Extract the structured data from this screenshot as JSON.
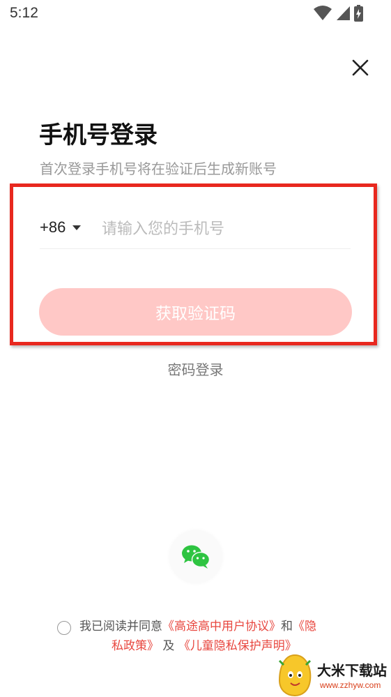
{
  "status_bar": {
    "time": "5:12",
    "icons": [
      "wifi-icon",
      "cellular-signal-icon",
      "battery-charging-icon"
    ]
  },
  "close_icon": "close-icon",
  "header": {
    "title": "手机号登录",
    "subtitle": "首次登录手机号将在验证后生成新账号"
  },
  "form": {
    "country_code": "+86",
    "phone_placeholder": "请输入您的手机号",
    "phone_value": "",
    "get_code_label": "获取验证码"
  },
  "alt_login": {
    "password_login_label": "密码登录",
    "wechat_icon": "wechat-icon"
  },
  "agreement": {
    "prefix": "我已阅读并同意",
    "user_agreement": "《高途高中用户协议》",
    "and": "和",
    "privacy_policy_part1": "《隐",
    "privacy_policy_part2": "私政策》",
    "and2": "及",
    "child_privacy": "《儿童隐私保护声明》"
  },
  "watermark": {
    "name": "大米下载站",
    "url": "www.zzhyw.com"
  },
  "colors": {
    "accent": "#e8473f",
    "button_disabled": "#ffc8c6",
    "highlight_border": "#e8281f",
    "wechat_green": "#2ec441"
  }
}
